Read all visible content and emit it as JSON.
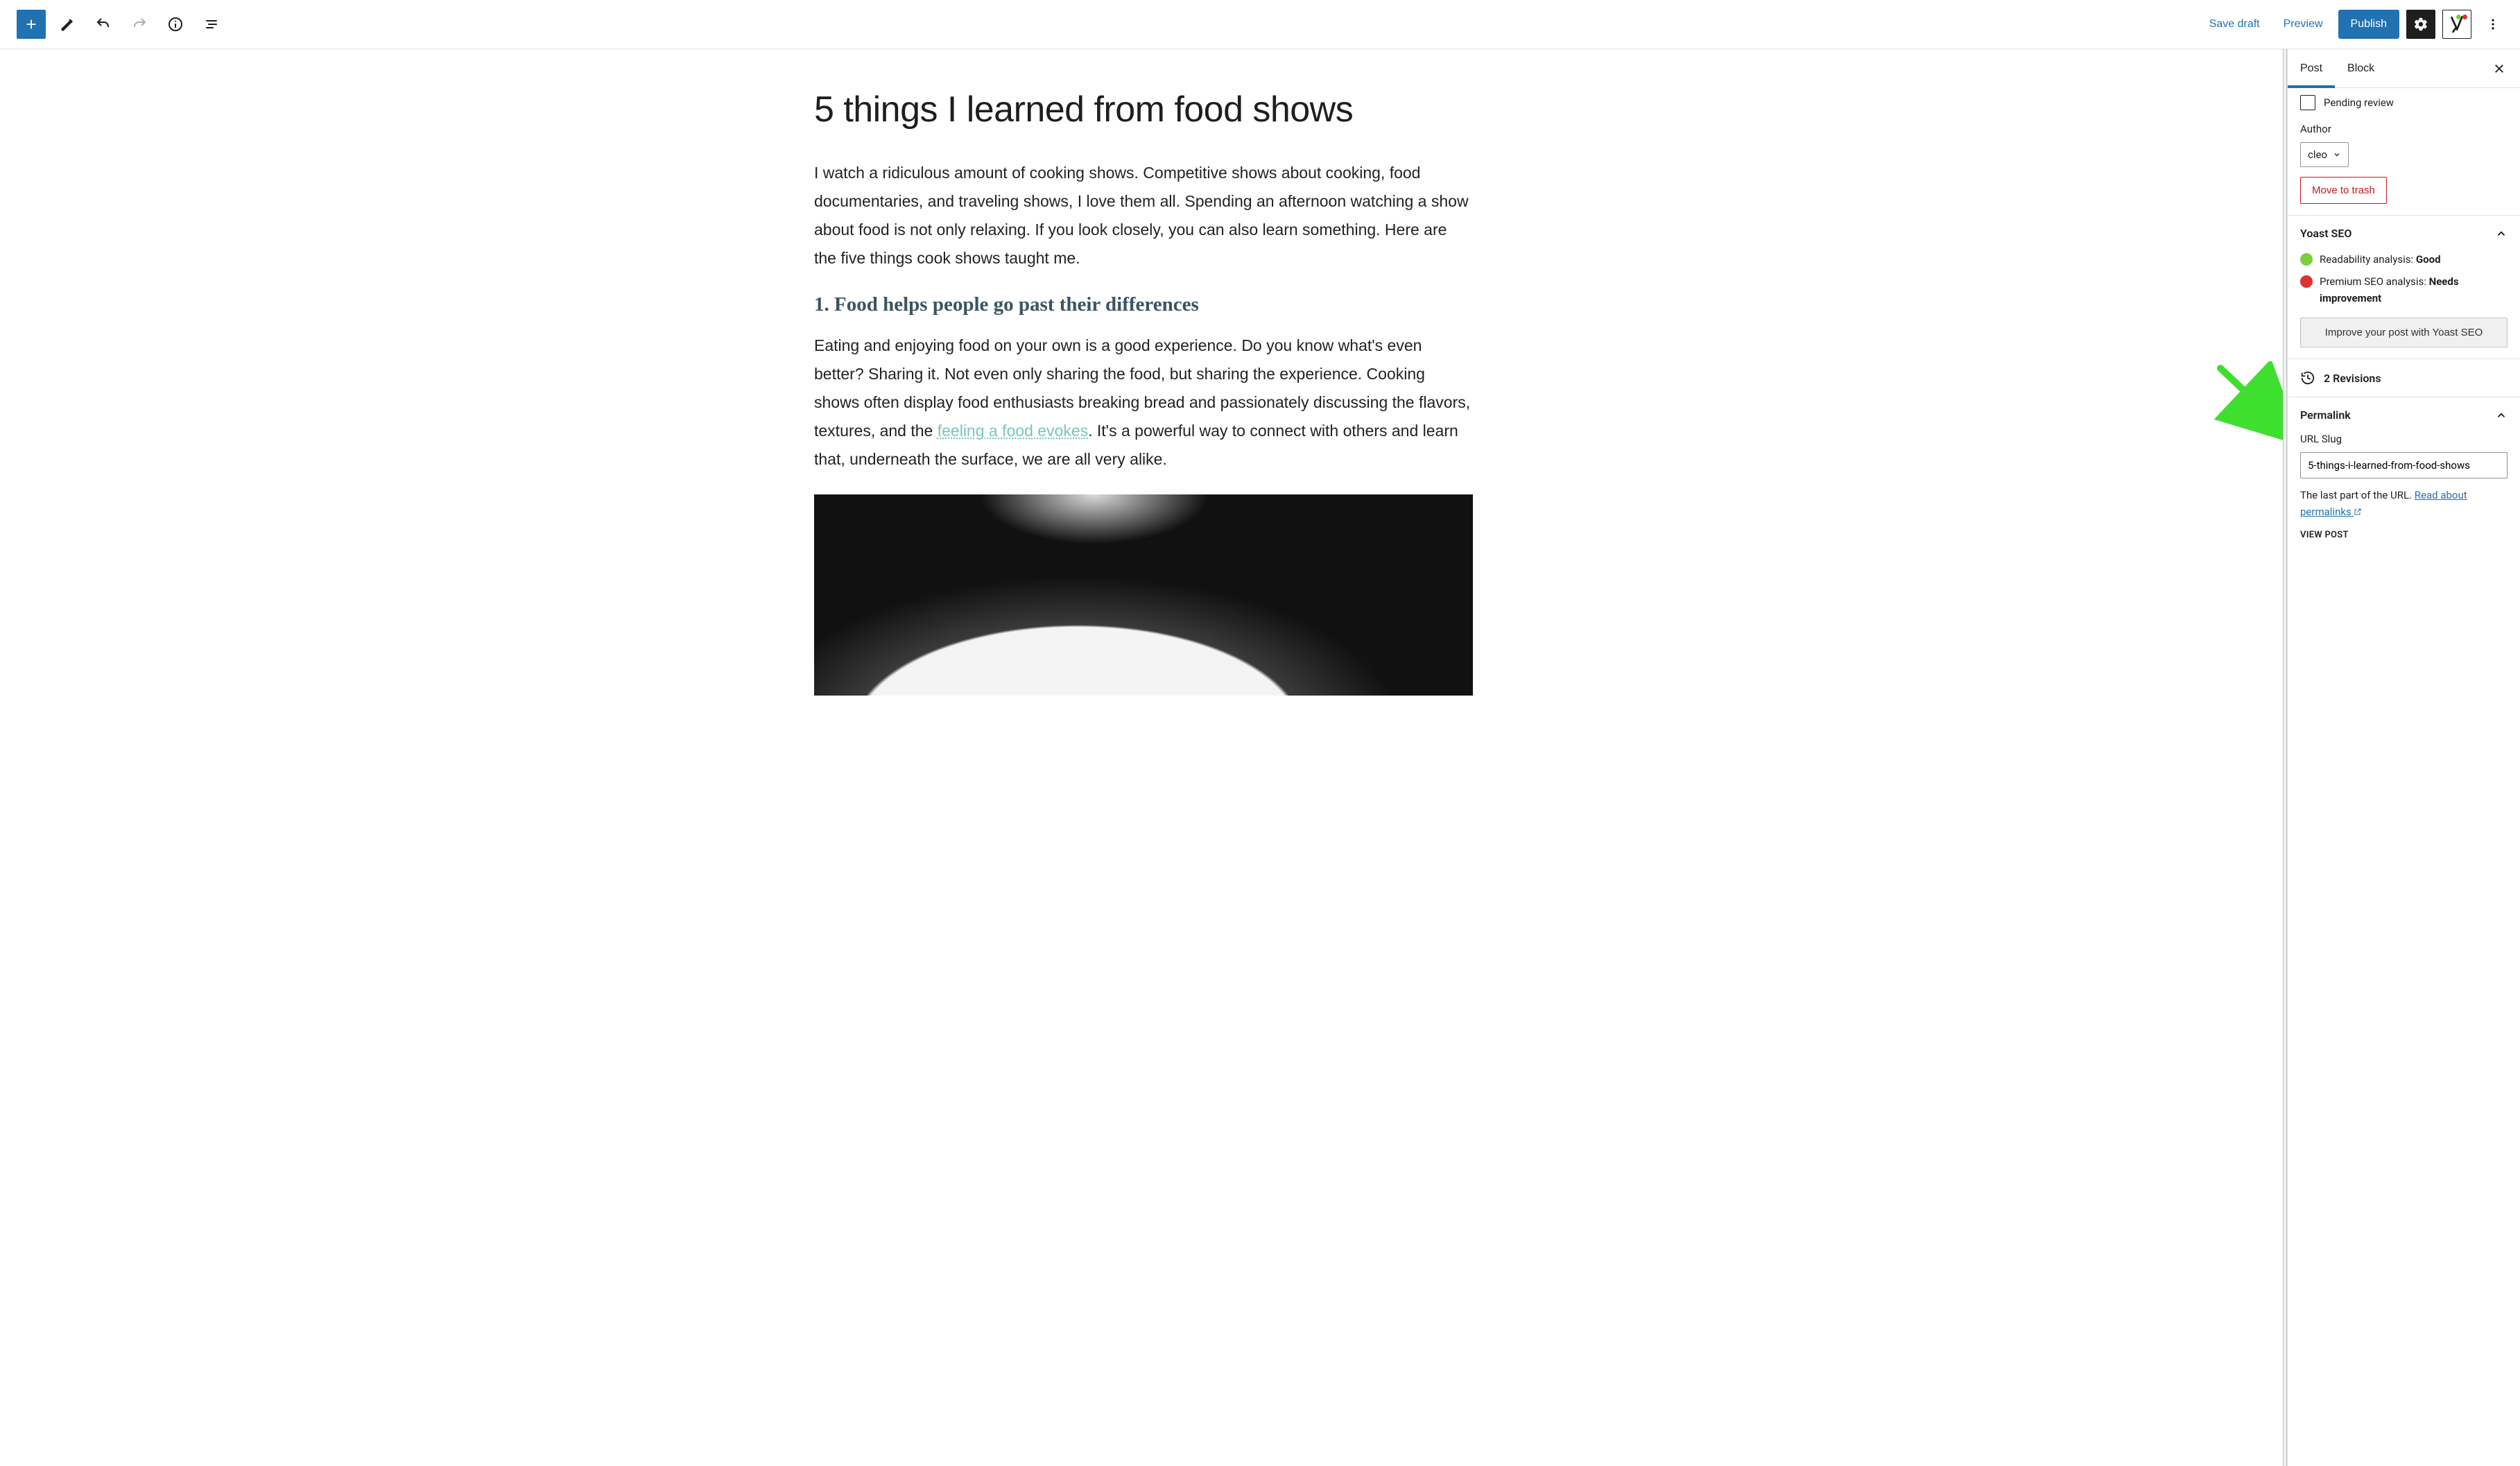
{
  "toolbar": {
    "save_draft": "Save draft",
    "preview": "Preview",
    "publish": "Publish"
  },
  "content": {
    "title": "5 things I learned from food shows",
    "intro": "I watch a ridiculous amount of cooking shows. Competitive shows about cooking, food documentaries, and traveling shows, I love them all. Spending an afternoon watching a show about food is not only relaxing. If you look closely, you can also learn something. Here are the five things cook shows taught me.",
    "h2_1": "1. Food helps people go past their differences",
    "p2_pre": "Eating and enjoying food on your own is a good experience. Do you know what's even better? Sharing it. Not even only sharing the food, but sharing the experience. Cooking shows often display food enthusiasts breaking bread and passionately discussing the flavors, textures, and the ",
    "p2_link": "feeling a food evokes",
    "p2_post": ". It's a powerful way to connect with others and learn that, underneath the surface, we are all very alike."
  },
  "sidebar": {
    "tabs": {
      "post": "Post",
      "block": "Block"
    },
    "pending_review": "Pending review",
    "author_label": "Author",
    "author_value": "cleo",
    "trash": "Move to trash",
    "yoast": {
      "title": "Yoast SEO",
      "readability_label": "Readability analysis: ",
      "readability_value": "Good",
      "premium_label": "Premium SEO analysis: ",
      "premium_value": "Needs improvement",
      "improve": "Improve your post with Yoast SEO"
    },
    "revisions": "2 Revisions",
    "permalink": {
      "title": "Permalink",
      "slug_label": "URL Slug",
      "slug_value": "5-things-i-learned-from-food-shows",
      "desc_pre": "The last part of the URL. ",
      "desc_link": "Read about permalinks",
      "view_post": "VIEW POST"
    }
  }
}
